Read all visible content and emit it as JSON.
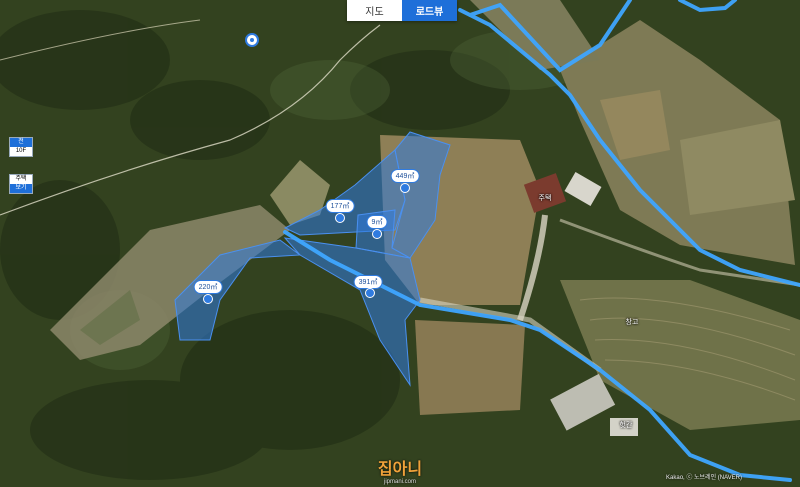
{
  "tabs": {
    "map_label": "지도",
    "roadview_label": "로드뷰",
    "active": "roadview"
  },
  "side_controls": {
    "ctrl1_top": "전",
    "ctrl1_bottom": "10F",
    "ctrl2_top": "주택",
    "ctrl2_bottom": "보기"
  },
  "parcels": [
    {
      "id": "p1",
      "label": "449㎡"
    },
    {
      "id": "p2",
      "label": "177㎡"
    },
    {
      "id": "p3",
      "label": "9㎡"
    },
    {
      "id": "p4",
      "label": "391㎡"
    },
    {
      "id": "p5",
      "label": "220㎡"
    }
  ],
  "pois": {
    "building1": "주택",
    "building2": "창고",
    "building3": "헛간"
  },
  "watermark": {
    "brand": "집아니",
    "url": "jipmani.com"
  },
  "credit": "Kakao, ⓒ 노브레인 (NAVER)",
  "colors": {
    "parcel_fill": "#2f7be0",
    "roadview_line": "#3fa6ff",
    "tab_active": "#1e6fd9"
  }
}
